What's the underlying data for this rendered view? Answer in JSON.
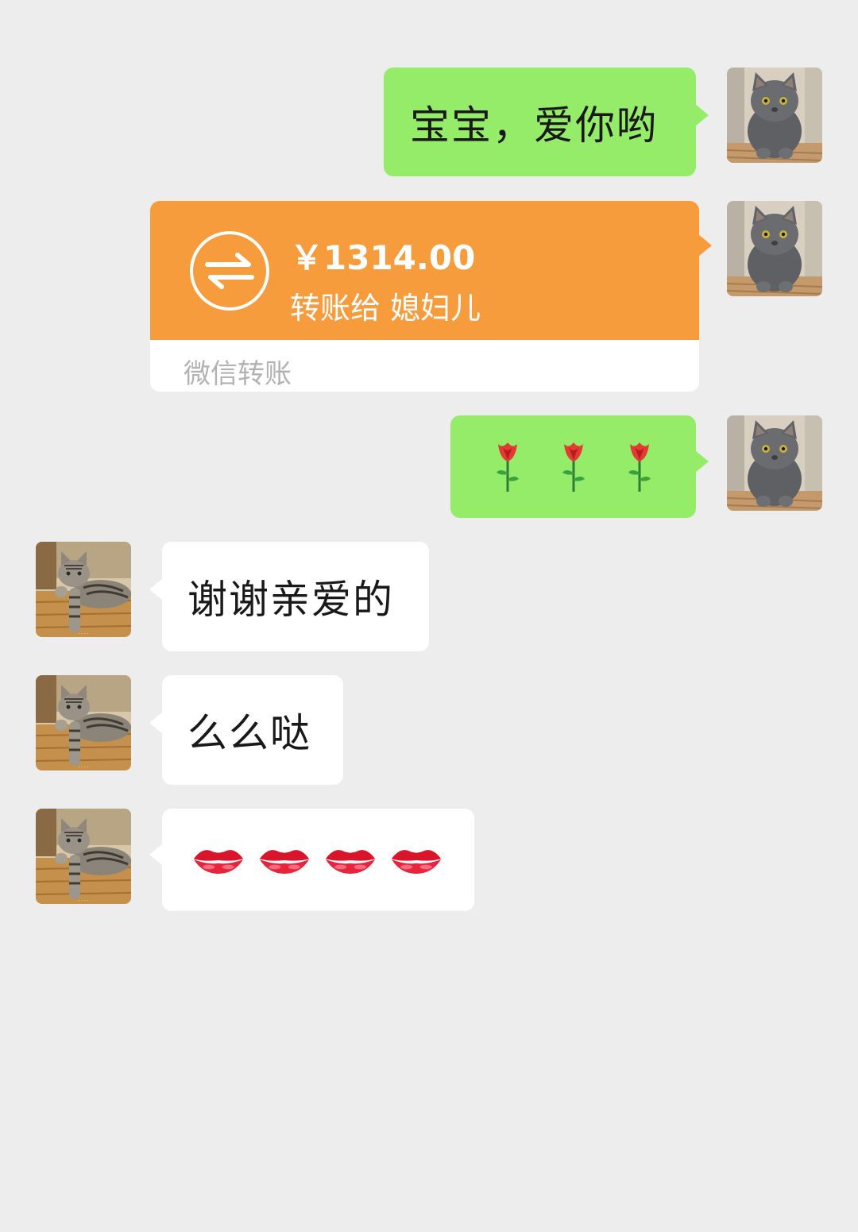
{
  "messages": {
    "m1": {
      "text": "宝宝，爱你哟"
    },
    "transfer": {
      "amount": "￥1314.00",
      "to_label": "转账给 媳妇儿",
      "footer": "微信转账",
      "icon": "transfer-arrows-icon"
    },
    "m3": {
      "emojis": [
        "rose",
        "rose",
        "rose"
      ]
    },
    "m4": {
      "text": "谢谢亲爱的"
    },
    "m5": {
      "text": "么么哒"
    },
    "m6": {
      "emojis": [
        "lips",
        "lips",
        "lips",
        "lips"
      ]
    }
  },
  "colors": {
    "background": "#ededed",
    "self_bubble": "#95ec69",
    "other_bubble": "#ffffff",
    "transfer": "#f79c3d",
    "text": "#191919",
    "muted": "#b2b2b2"
  },
  "avatars": {
    "self": "grey-cat-avatar",
    "other": "tabby-cat-avatar"
  }
}
